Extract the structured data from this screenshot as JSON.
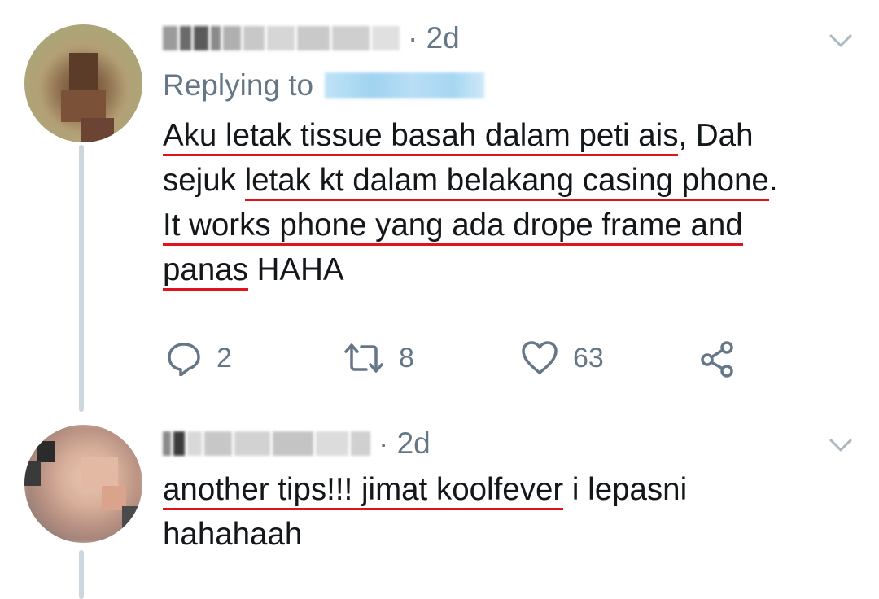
{
  "tweets": [
    {
      "time": "· 2d",
      "replying_label": "Replying to",
      "text_lines": [
        [
          {
            "t": "Aku letak tissue basah dalam peti ais",
            "u": true
          },
          {
            "t": ", Dah",
            "u": false
          }
        ],
        [
          {
            "t": "sejuk ",
            "u": false
          },
          {
            "t": "letak kt dalam belakang casing phone",
            "u": true
          },
          {
            "t": ".",
            "u": false
          }
        ],
        [
          {
            "t": "It works phone yang ada drope frame and",
            "u": true
          }
        ],
        [
          {
            "t": "panas",
            "u": true
          },
          {
            "t": " HAHA",
            "u": false
          }
        ]
      ],
      "actions": {
        "replies": "2",
        "retweets": "8",
        "likes": "63"
      },
      "icons": {
        "reply": "reply-icon",
        "retweet": "retweet-icon",
        "like": "heart-icon",
        "share": "share-icon",
        "more": "chevron-down-icon"
      }
    },
    {
      "time": "· 2d",
      "text_lines": [
        [
          {
            "t": "another tips!!! jimat koolfever",
            "u": true
          },
          {
            "t": " i lepasni",
            "u": false
          }
        ],
        [
          {
            "t": "hahahaah",
            "u": false
          }
        ]
      ],
      "icons": {
        "more": "chevron-down-icon"
      }
    }
  ],
  "colors": {
    "text": "#14171a",
    "muted": "#657786",
    "thread_line": "#ccd6dd",
    "underline": "#e1141d",
    "handle_blue": "#9fd3f0"
  }
}
